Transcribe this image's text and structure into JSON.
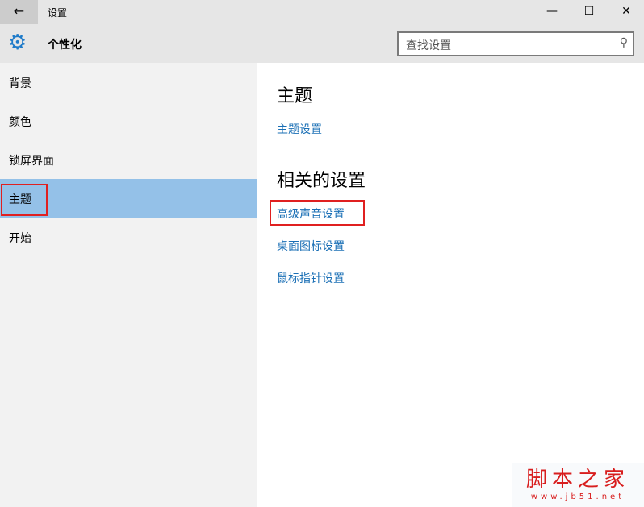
{
  "window": {
    "title": "设置",
    "back": "←",
    "minimize": "—",
    "maximize": "☐",
    "close": "✕"
  },
  "header": {
    "title": "个性化",
    "search_placeholder": "查找设置",
    "search_icon": "⚲"
  },
  "sidebar": {
    "items": [
      {
        "label": "背景"
      },
      {
        "label": "颜色"
      },
      {
        "label": "锁屏界面"
      },
      {
        "label": "主题",
        "selected": true
      },
      {
        "label": "开始"
      }
    ]
  },
  "main": {
    "section1": "主题",
    "link1": "主题设置",
    "section2": "相关的设置",
    "links": [
      "高级声音设置",
      "桌面图标设置",
      "鼠标指针设置"
    ]
  },
  "watermark": {
    "name": "脚本之家",
    "url": "www.jb51.net"
  }
}
